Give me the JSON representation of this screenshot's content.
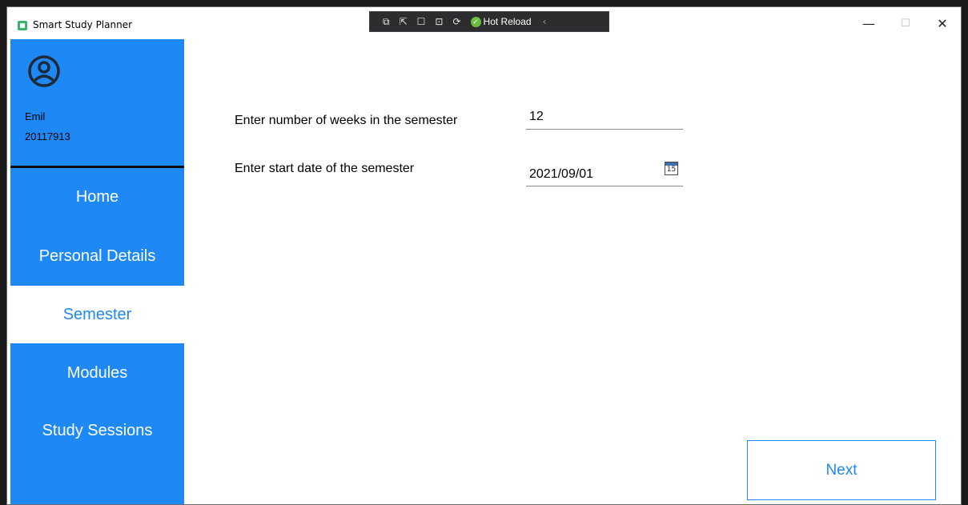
{
  "window": {
    "title": "Smart Study Planner",
    "controls": {
      "minimize": "—",
      "maximize": "☐",
      "close": "✕"
    }
  },
  "debug_toolbar": {
    "tools": [
      "⧉",
      "⇱",
      "☐",
      "⊡",
      "⟳"
    ],
    "hot_reload_label": "Hot Reload",
    "collapse": "‹"
  },
  "sidebar": {
    "user": {
      "name": "Emil",
      "id": "20117913",
      "icon": "user-circle-icon"
    },
    "nav": [
      {
        "label": "Home",
        "active": false
      },
      {
        "label": "Personal Details",
        "active": false
      },
      {
        "label": "Semester",
        "active": true
      },
      {
        "label": "Modules",
        "active": false
      },
      {
        "label": "Study Sessions",
        "active": false
      }
    ]
  },
  "form": {
    "weeks_label": "Enter number of weeks in the semester",
    "weeks_value": "12",
    "start_label": "Enter start date of the semester",
    "start_value": "2021/09/01",
    "calendar_day": "15"
  },
  "actions": {
    "next_label": "Next"
  },
  "colors": {
    "accent": "#1e88f5",
    "sidebar_bg": "#1e88f5",
    "active_bg": "#ffffff"
  }
}
